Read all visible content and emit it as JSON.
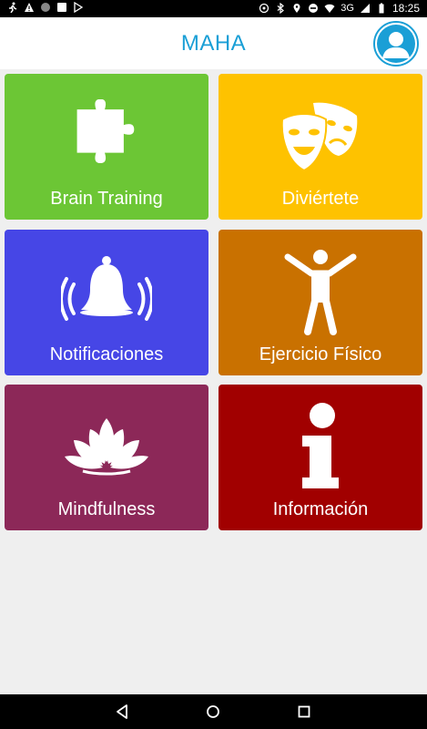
{
  "status_bar": {
    "time": "18:25",
    "network": "3G",
    "left_icons": [
      "runner-icon",
      "warning-icon",
      "circle-icon",
      "square-icon",
      "play-store-icon"
    ],
    "right_icons": [
      "sync-icon",
      "bluetooth-icon",
      "location-icon",
      "do-not-disturb-icon",
      "wifi-icon",
      "signal-icon",
      "battery-icon"
    ]
  },
  "app_bar": {
    "title": "MAHA",
    "avatar_icon": "user-avatar-icon"
  },
  "tiles": [
    {
      "label": "Brain Training",
      "icon": "puzzle-piece-icon",
      "color": "#6cc635"
    },
    {
      "label": "Diviértete",
      "icon": "theater-masks-icon",
      "color": "#fec200"
    },
    {
      "label": "Notificaciones",
      "icon": "ringing-bell-icon",
      "color": "#4646e6"
    },
    {
      "label": "Ejercicio Físico",
      "icon": "person-exercise-icon",
      "color": "#c97100"
    },
    {
      "label": "Mindfulness",
      "icon": "lotus-icon",
      "color": "#8c2858"
    },
    {
      "label": "Información",
      "icon": "info-icon",
      "color": "#a10000"
    }
  ],
  "nav_bar": {
    "buttons": [
      "back-icon",
      "home-icon",
      "recents-icon"
    ]
  },
  "colors": {
    "accent": "#1a9fd6",
    "background": "#efefef"
  }
}
